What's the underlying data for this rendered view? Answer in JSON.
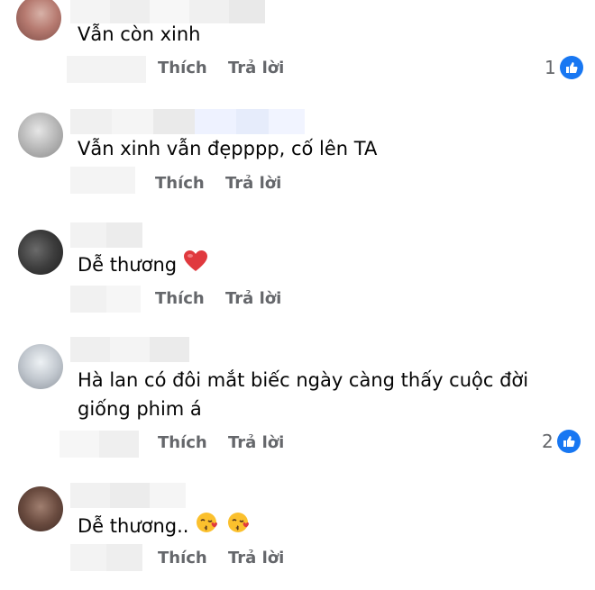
{
  "comments": [
    {
      "text": "Vẫn còn xinh",
      "like_action": "Thích",
      "reply_action": "Trả lời",
      "reaction_count": "1"
    },
    {
      "text": "Vẫn xinh vẫn đẹpppp, cố lên TA",
      "like_action": "Thích",
      "reply_action": "Trả lời"
    },
    {
      "text": "Dễ thương",
      "emoji": "heart",
      "like_action": "Thích",
      "reply_action": "Trả lời"
    },
    {
      "text_line1": "Hà lan có đôi mắt biếc ngày càng thấy cuộc đời",
      "text_line2": "giống phim á",
      "like_action": "Thích",
      "reply_action": "Trả lời",
      "reaction_count": "2"
    },
    {
      "text": "Dễ thương..",
      "emoji": "kissing-face-with-heart",
      "like_action": "Thích",
      "reply_action": "Trả lời"
    }
  ],
  "colors": {
    "text": "#050505",
    "meta": "#65676b",
    "like_blue": "#1877f2",
    "heart_red": "#e0393e",
    "emoji_yellow": "#fbc02d"
  }
}
